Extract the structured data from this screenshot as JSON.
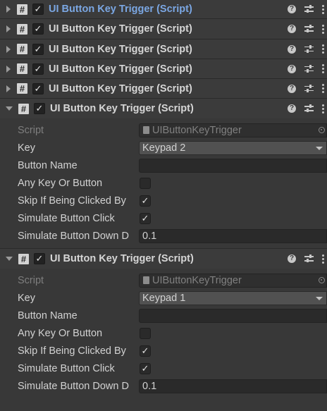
{
  "components": [
    {
      "title": "UI Button Key Trigger (Script)",
      "highlighted": true,
      "expanded": false,
      "enabled_mark": "✓"
    },
    {
      "title": "UI Button Key Trigger (Script)",
      "highlighted": false,
      "expanded": false,
      "enabled_mark": "✓"
    },
    {
      "title": "UI Button Key Trigger (Script)",
      "highlighted": false,
      "expanded": false,
      "enabled_mark": "✓"
    },
    {
      "title": "UI Button Key Trigger (Script)",
      "highlighted": false,
      "expanded": false,
      "enabled_mark": "✓"
    },
    {
      "title": "UI Button Key Trigger (Script)",
      "highlighted": false,
      "expanded": false,
      "enabled_mark": "✓"
    }
  ],
  "expanded_components": [
    {
      "title": "UI Button Key Trigger (Script)",
      "enabled_mark": "✓",
      "script_label": "Script",
      "script_value": "UIButtonKeyTrigger",
      "key_label": "Key",
      "key_value": "Keypad 2",
      "button_name_label": "Button Name",
      "button_name_value": "",
      "any_key_label": "Any Key Or Button",
      "any_key_mark": "",
      "skip_label": "Skip If Being Clicked By",
      "skip_mark": "✓",
      "simulate_click_label": "Simulate Button Click",
      "simulate_click_mark": "✓",
      "simulate_down_label": "Simulate Button Down D",
      "simulate_down_value": "0.1"
    },
    {
      "title": "UI Button Key Trigger (Script)",
      "enabled_mark": "✓",
      "script_label": "Script",
      "script_value": "UIButtonKeyTrigger",
      "key_label": "Key",
      "key_value": "Keypad 1",
      "button_name_label": "Button Name",
      "button_name_value": "",
      "any_key_label": "Any Key Or Button",
      "any_key_mark": "",
      "skip_label": "Skip If Being Clicked By",
      "skip_mark": "✓",
      "simulate_click_label": "Simulate Button Click",
      "simulate_click_mark": "✓",
      "simulate_down_label": "Simulate Button Down D",
      "simulate_down_value": "0.1"
    }
  ],
  "header_icons": {
    "help": "?",
    "help_icon": "help-icon",
    "presets_icon": "presets-icon",
    "menu_icon": "kebab-menu-icon"
  },
  "colors": {
    "background": "#383838",
    "header": "#3b3b3b",
    "highlight_title": "#7ba7e3"
  }
}
